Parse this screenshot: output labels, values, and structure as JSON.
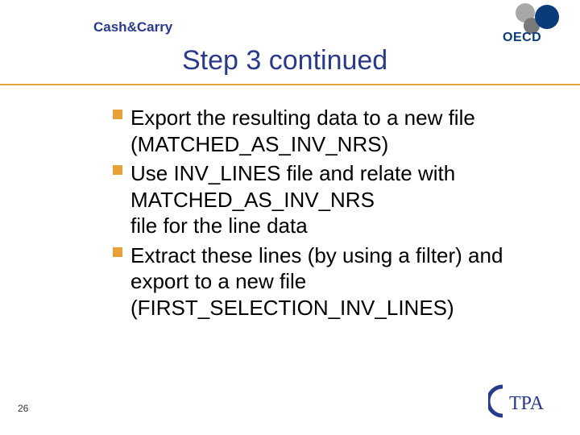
{
  "header": {
    "small_title": "Cash&Carry",
    "title": "Step 3 continued",
    "oecd_label": "OECD"
  },
  "bullets": [
    "Export the resulting data to a new file (MATCHED_AS_INV_NRS)",
    "Use INV_LINES file and relate with MATCHED_AS_INV_NRS file for the line data",
    "Extract these lines (by using a filter) and export to a new file (FIRST_SELECTION_INV_LINES)"
  ],
  "footer": {
    "page_number": "26",
    "ctpa_label": "TPA"
  }
}
